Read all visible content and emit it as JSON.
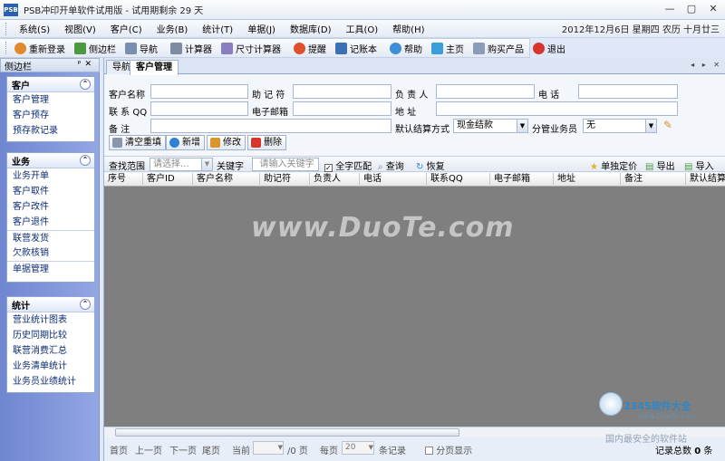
{
  "window": {
    "logo_text": "PSB",
    "title": "PSB冲印开单软件试用版 - 试用期剩余 29 天",
    "minimize": "—",
    "restore": "▢",
    "close": "✕"
  },
  "menu": {
    "items": [
      "系统(S)",
      "视图(V)",
      "客户(C)",
      "业务(B)",
      "统计(T)",
      "单据(J)",
      "数据库(D)",
      "工具(O)",
      "帮助(H)"
    ],
    "date": "2012年12月6日 星期四 农历 十月廿三"
  },
  "toolbar": {
    "items": [
      {
        "label": "重新登录",
        "icon": "person-icon",
        "color": "#e08a2c"
      },
      {
        "label": "侧边栏",
        "icon": "tag-icon",
        "color": "#4c9a3f"
      },
      {
        "label": "导航",
        "icon": "monitor-icon",
        "color": "#7a8fb0"
      },
      {
        "label": "计算器",
        "icon": "calculator-icon",
        "color": "#7d8ba3"
      },
      {
        "label": "尺寸计算器",
        "icon": "ruler-icon",
        "color": "#8a7dc0"
      },
      {
        "label": "提醒",
        "icon": "alarm-icon",
        "color": "#e0502c"
      },
      {
        "label": "记账本",
        "icon": "book-icon",
        "color": "#3b6fb6"
      },
      {
        "label": "帮助",
        "icon": "help-icon",
        "color": "#3d8fd8"
      },
      {
        "label": "主页",
        "icon": "home-icon",
        "color": "#3a9ed8"
      },
      {
        "label": "购买产品",
        "icon": "cart-icon",
        "color": "#8a9cb8"
      },
      {
        "label": "退出",
        "icon": "exit-icon",
        "color": "#d8352c"
      }
    ]
  },
  "sidebar": {
    "title": "侧边栏",
    "pin": "ᵖ",
    "close": "✕",
    "groups": [
      {
        "title": "客户",
        "items": [
          "客户管理",
          "客户预存",
          "预存款记录"
        ]
      },
      {
        "title": "业务",
        "items": [
          "业务开单",
          "客户取件",
          "客户改件",
          "客户退件",
          "联营发货",
          "欠款核销",
          "单据管理"
        ]
      },
      {
        "title": "统计",
        "items": [
          "营业统计图表",
          "历史同期比较",
          "联营消费汇总",
          "业务清单统计",
          "业务员业绩统计"
        ]
      }
    ],
    "collapse_glyph": "⌃"
  },
  "tabs": {
    "items": [
      "导航",
      "客户管理"
    ],
    "nav": "◂ ▸ ✕"
  },
  "form": {
    "labels": {
      "name": "客户名称",
      "memo_code": "助 记 符",
      "manager": "负 责 人",
      "phone": "电    话",
      "qq": "联 系 QQ",
      "email": "电子邮箱",
      "address": "地    址",
      "remark": "备    注",
      "settle": "默认结算方式",
      "salesman": "分管业务员"
    },
    "settle_value": "现金结款",
    "salesman_value": "无",
    "buttons": {
      "reset": "清空重填",
      "add": "新增",
      "edit": "修改",
      "delete": "删除"
    }
  },
  "search": {
    "range_label": "查找范围",
    "range_placeholder": "请选择...",
    "keyword_label": "关键字",
    "keyword_placeholder": "请输入关键字",
    "fullmatch_label": "全字匹配",
    "query": "查询",
    "restore": "恢复",
    "single_price": "单独定价",
    "export": "导出",
    "import": "导入"
  },
  "grid": {
    "columns": [
      "序号",
      "客户ID",
      "客户名称",
      "助记符",
      "负责人",
      "电话",
      "联系QQ",
      "电子邮箱",
      "地址",
      "备注",
      "默认结算"
    ]
  },
  "pager": {
    "first": "首页",
    "prev": "上一页",
    "next": "下一页",
    "last": "尾页",
    "current_label": "当前",
    "total_pages": "/0 页",
    "per_page_label": "每页",
    "per_page_value": "20",
    "records_unit": "条记录",
    "paged_display": "分页显示",
    "total_label": "记录总数",
    "total_count": "0",
    "total_unit": "条"
  },
  "watermark": "www.DuoTe.com",
  "branding": {
    "name": "2345软件大全",
    "url": "www.DuoTe.com",
    "slogan": "国内最安全的软件站"
  }
}
